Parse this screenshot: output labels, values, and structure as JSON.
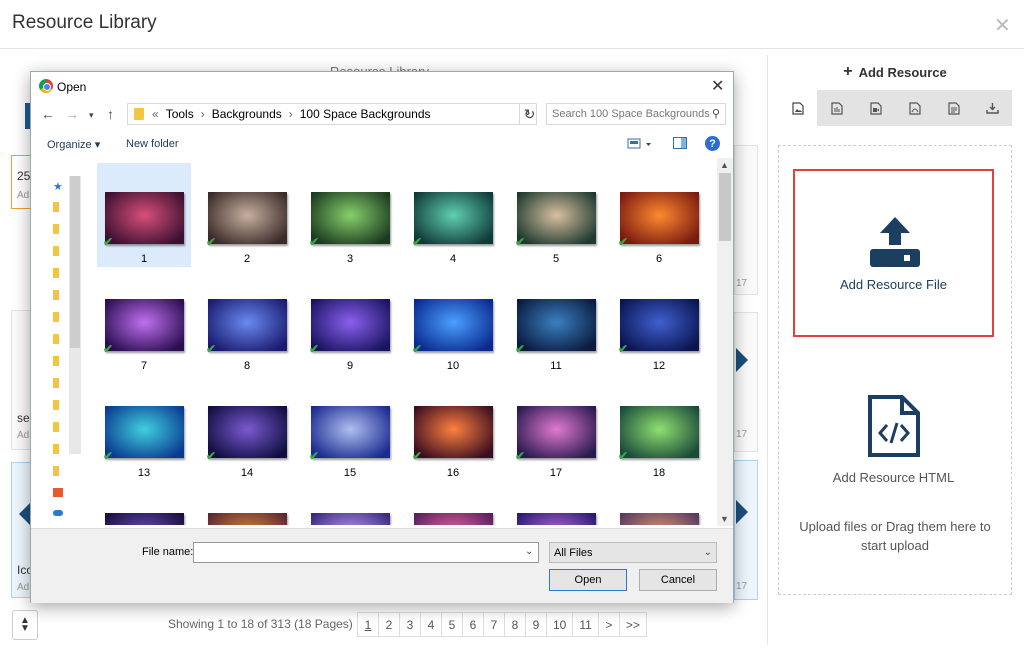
{
  "header": {
    "title": "Resource Library",
    "close": "✕"
  },
  "background": {
    "library_label": "Resource Library",
    "cards": [
      {
        "text": "25",
        "sub": "Ad"
      },
      {
        "text": "se",
        "sub": "Ad"
      },
      {
        "text": "Ico",
        "sub": "Ad"
      }
    ],
    "right_dates": [
      "17",
      "17",
      "17"
    ]
  },
  "footer": {
    "showing": "Showing 1 to 18 of 313 (18 Pages)",
    "pages": [
      "1",
      "2",
      "3",
      "4",
      "5",
      "6",
      "7",
      "8",
      "9",
      "10",
      "11",
      ">",
      ">>"
    ]
  },
  "right_panel": {
    "add_resource": "Add Resource",
    "type_icons": [
      "image-type-icon",
      "audio-type-icon",
      "video-type-icon",
      "pdf-type-icon",
      "document-type-icon",
      "download-type-icon"
    ],
    "add_file_label": "Add Resource File",
    "add_html_label": "Add Resource HTML",
    "upload_hint": "Upload files or Drag them here to start upload"
  },
  "dialog": {
    "title": "Open",
    "breadcrumb": [
      "Tools",
      "Backgrounds",
      "100 Space Backgrounds"
    ],
    "search_placeholder": "Search 100 Space Backgrounds",
    "organize": "Organize ▾",
    "new_folder": "New folder",
    "help": "?",
    "files": [
      {
        "label": "1",
        "c1": "#d84f7a",
        "c2": "#3a1030"
      },
      {
        "label": "2",
        "c1": "#c7b0a0",
        "c2": "#3a2a28"
      },
      {
        "label": "3",
        "c1": "#88d06a",
        "c2": "#1a3a20"
      },
      {
        "label": "4",
        "c1": "#5fd0b0",
        "c2": "#103a38"
      },
      {
        "label": "5",
        "c1": "#d8c0a0",
        "c2": "#1e3a30"
      },
      {
        "label": "6",
        "c1": "#ff8a30",
        "c2": "#7a1a10"
      },
      {
        "label": "7",
        "c1": "#c070f0",
        "c2": "#2a0e50"
      },
      {
        "label": "8",
        "c1": "#6a8af0",
        "c2": "#1a1a70"
      },
      {
        "label": "9",
        "c1": "#8a60f0",
        "c2": "#1a1460"
      },
      {
        "label": "10",
        "c1": "#4aa0ff",
        "c2": "#0a2a90"
      },
      {
        "label": "11",
        "c1": "#3a80c0",
        "c2": "#0a1a40"
      },
      {
        "label": "12",
        "c1": "#4060d0",
        "c2": "#0a1450"
      },
      {
        "label": "13",
        "c1": "#40d0e0",
        "c2": "#0a3a90"
      },
      {
        "label": "14",
        "c1": "#7a5ad0",
        "c2": "#100e40"
      },
      {
        "label": "15",
        "c1": "#b0c0f0",
        "c2": "#1a2a90"
      },
      {
        "label": "16",
        "c1": "#ff8040",
        "c2": "#3a0e20"
      },
      {
        "label": "17",
        "c1": "#e07ad0",
        "c2": "#2a1a50"
      },
      {
        "label": "18",
        "c1": "#90e070",
        "c2": "#1a4a3a"
      },
      {
        "label": "",
        "c1": "#7050c0",
        "c2": "#1a1040"
      },
      {
        "label": "",
        "c1": "#e08a40",
        "c2": "#5a2a30"
      },
      {
        "label": "",
        "c1": "#c0a0f0",
        "c2": "#3a2a80"
      },
      {
        "label": "",
        "c1": "#f06aa0",
        "c2": "#5a2060"
      },
      {
        "label": "",
        "c1": "#c070e0",
        "c2": "#2a1a70"
      },
      {
        "label": "",
        "c1": "#e0a070",
        "c2": "#5a3a60"
      }
    ],
    "filename_label": "File name:",
    "filename_value": "",
    "filter": "All Files",
    "open_button": "Open",
    "cancel_button": "Cancel"
  }
}
